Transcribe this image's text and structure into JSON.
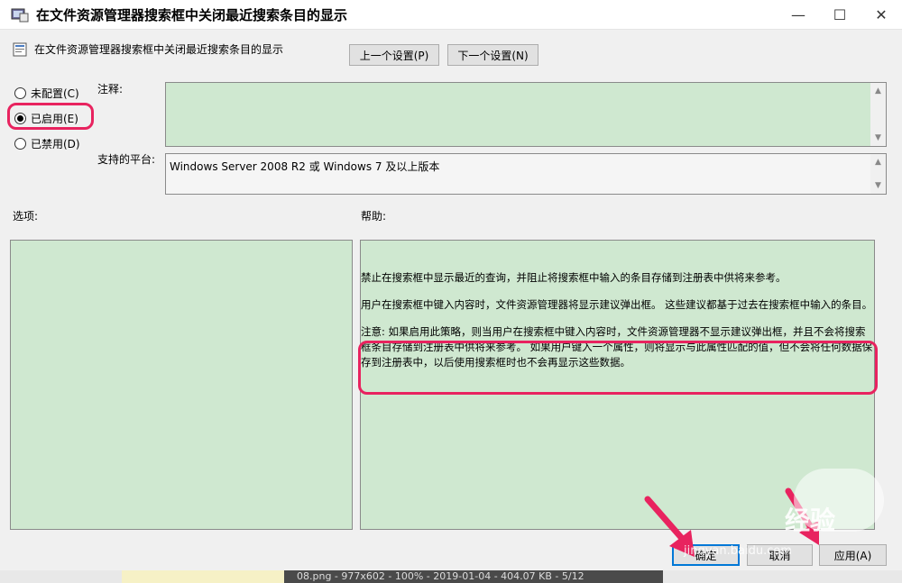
{
  "window": {
    "title": "在文件资源管理器搜索框中关闭最近搜索条目的显示",
    "minimize": "—",
    "maximize": "☐",
    "close": "✕"
  },
  "header": {
    "policy_name": "在文件资源管理器搜索框中关闭最近搜索条目的显示",
    "prev_button": "上一个设置(P)",
    "next_button": "下一个设置(N)"
  },
  "state": {
    "options": [
      {
        "label": "未配置(C)",
        "selected": false
      },
      {
        "label": "已启用(E)",
        "selected": true
      },
      {
        "label": "已禁用(D)",
        "selected": false
      }
    ]
  },
  "comment": {
    "label": "注释:",
    "value": ""
  },
  "platform": {
    "label": "支持的平台:",
    "value": "Windows Server 2008 R2 或 Windows 7 及以上版本"
  },
  "options_section": {
    "label": "选项:"
  },
  "help_section": {
    "label": "帮助:",
    "paragraphs": [
      "禁止在搜索框中显示最近的查询，并阻止将搜索框中输入的条目存储到注册表中供将来参考。",
      "用户在搜索框中键入内容时，文件资源管理器将显示建议弹出框。 这些建议都基于过去在搜索框中输入的条目。",
      "注意: 如果启用此策略，则当用户在搜索框中键入内容时，文件资源管理器不显示建议弹出框，并且不会将搜索框条目存储到注册表中供将来参考。 如果用户键入一个属性，则将显示与此属性匹配的值，但不会将任何数据保存到注册表中，以后使用搜索框时也不会再显示这些数据。"
    ]
  },
  "footer": {
    "ok_button": "确定",
    "cancel_button": "取消",
    "apply_button": "应用(A)"
  },
  "overlay": {
    "watermark": "jingyan.baidu.com",
    "logo_text": "经验",
    "taskbar_text": "08.png - 977x602 - 100% - 2019-01-04 - 404.07 KB - 5/12"
  },
  "colors": {
    "highlight": "#e8235f",
    "panel_green": "#cfe8d0",
    "accent": "#0078d7"
  }
}
